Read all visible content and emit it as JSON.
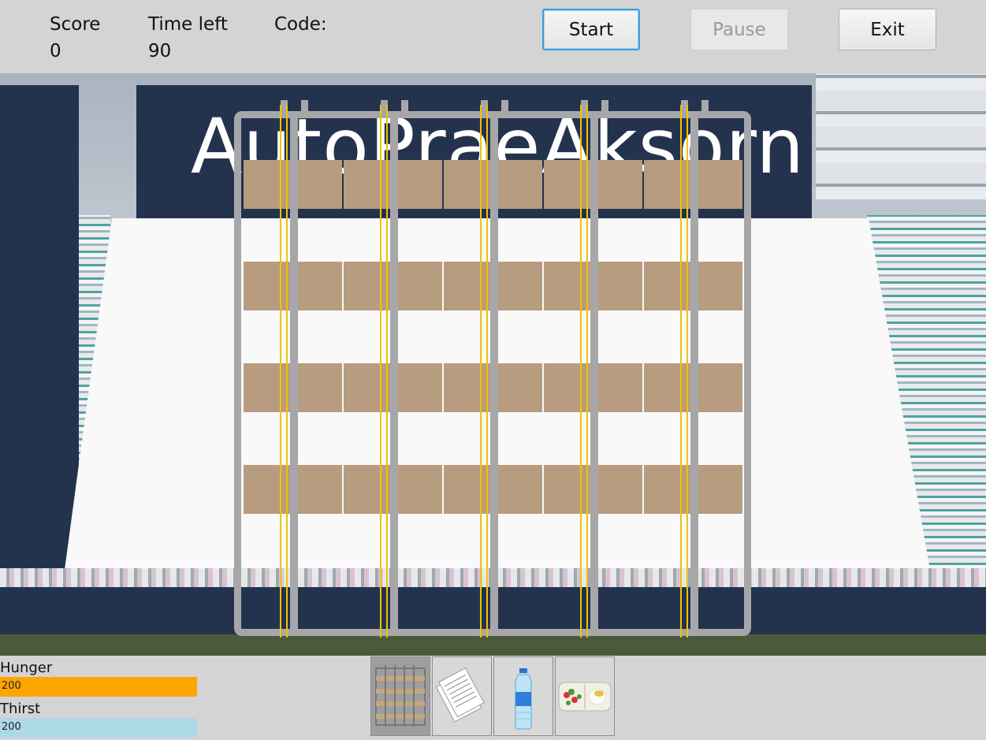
{
  "hud": {
    "score_label": "Score",
    "score_value": "0",
    "time_label": "Time left",
    "time_value": "90",
    "code_label": "Code:",
    "code_value": ""
  },
  "buttons": {
    "start": "Start",
    "pause": "Pause",
    "exit": "Exit"
  },
  "scene": {
    "sign_text": "AutoPraeAksorn"
  },
  "status": {
    "hunger_label": "Hunger",
    "hunger_value": "200",
    "hunger_color": "#ffa500",
    "thirst_label": "Thirst",
    "thirst_value": "200",
    "thirst_color": "#add8e6"
  },
  "inventory": {
    "items": [
      "grid-frame-icon",
      "paper-sheets-icon",
      "water-bottle-icon",
      "food-box-icon"
    ],
    "selected": 0
  }
}
